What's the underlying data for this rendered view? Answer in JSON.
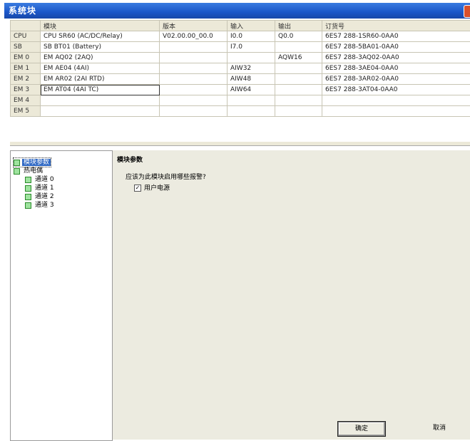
{
  "window": {
    "title": "系统块"
  },
  "table": {
    "headers": [
      "",
      "模块",
      "版本",
      "输入",
      "输出",
      "订货号"
    ],
    "rows": [
      [
        "CPU",
        "CPU SR60 (AC/DC/Relay)",
        "V02.00.00_00.0",
        "I0.0",
        "Q0.0",
        "6ES7 288-1SR60-0AA0"
      ],
      [
        "SB",
        "SB BT01 (Battery)",
        "",
        "I7.0",
        "",
        "6ES7 288-5BA01-0AA0"
      ],
      [
        "EM 0",
        "EM AQ02 (2AQ)",
        "",
        "",
        "AQW16",
        "6ES7 288-3AQ02-0AA0"
      ],
      [
        "EM 1",
        "EM AE04 (4AI)",
        "",
        "AIW32",
        "",
        "6ES7 288-3AE04-0AA0"
      ],
      [
        "EM 2",
        "EM AR02 (2AI RTD)",
        "",
        "AIW48",
        "",
        "6ES7 288-3AR02-0AA0"
      ],
      [
        "EM 3",
        "EM AT04 (4AI TC)",
        "",
        "AIW64",
        "",
        "6ES7 288-3AT04-0AA0"
      ],
      [
        "EM 4",
        "",
        "",
        "",
        "",
        ""
      ],
      [
        "EM 5",
        "",
        "",
        "",
        "",
        ""
      ]
    ]
  },
  "tree": {
    "items": [
      {
        "label": "模块参数",
        "selected": true
      },
      {
        "label": "热电偶",
        "selected": false
      },
      {
        "label": "通道 0",
        "selected": false
      },
      {
        "label": "通道 1",
        "selected": false
      },
      {
        "label": "通道 2",
        "selected": false
      },
      {
        "label": "通道 3",
        "selected": false
      }
    ]
  },
  "params": {
    "title": "模块参数",
    "question": "应该为此模块启用哪些报警?",
    "checkbox_label": "用户电源",
    "checkbox_checked": true
  },
  "buttons": {
    "ok": "确定",
    "cancel": "取消"
  }
}
